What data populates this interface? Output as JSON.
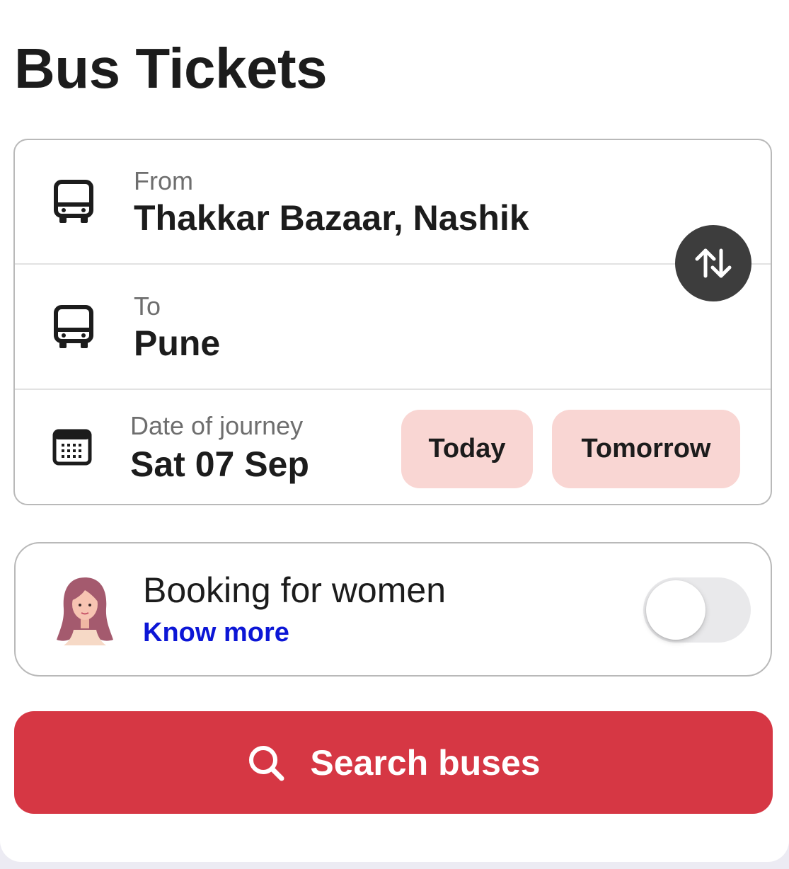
{
  "page": {
    "title": "Bus Tickets"
  },
  "route": {
    "from": {
      "label": "From",
      "value": "Thakkar Bazaar, Nashik",
      "icon": "bus-icon"
    },
    "to": {
      "label": "To",
      "value": "Pune",
      "icon": "bus-icon"
    },
    "swap_icon": "swap-arrows-icon"
  },
  "journey": {
    "label": "Date of journey",
    "value": "Sat 07 Sep",
    "icon": "calendar-icon",
    "quick_dates": [
      "Today",
      "Tomorrow"
    ]
  },
  "women_booking": {
    "title": "Booking for women",
    "link": "Know more",
    "enabled": false,
    "icon": "woman-avatar-icon"
  },
  "search": {
    "label": "Search buses",
    "icon": "search-icon"
  },
  "colors": {
    "accent": "#d63744",
    "chip_bg": "#f9d6d3",
    "link": "#0c16d6",
    "swap_bg": "#3d3d3d"
  }
}
